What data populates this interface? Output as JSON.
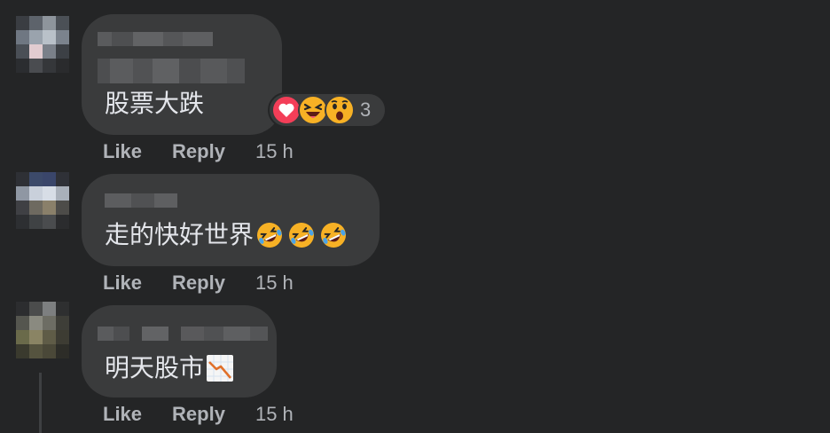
{
  "comments": [
    {
      "text": "股票大跌",
      "actions": {
        "like": "Like",
        "reply": "Reply",
        "time": "15 h"
      },
      "reactions": {
        "icons": [
          "heart-icon",
          "laughing-squint-icon",
          "wow-icon"
        ],
        "count": "3"
      }
    },
    {
      "text": "走的快好世界",
      "emojis": [
        "rolling-on-floor-laughing-icon",
        "rolling-on-floor-laughing-icon",
        "rolling-on-floor-laughing-icon"
      ],
      "actions": {
        "like": "Like",
        "reply": "Reply",
        "time": "15 h"
      }
    },
    {
      "text": "明天股市",
      "emojis": [
        "chart-decreasing-icon"
      ],
      "actions": {
        "like": "Like",
        "reply": "Reply",
        "time": "15 h"
      }
    }
  ],
  "colors": {
    "background": "#242526",
    "bubble": "#3a3b3c",
    "text": "#e4e6eb",
    "secondary_text": "#b0b3b8",
    "heart_red": "#f33e58",
    "emoji_yellow": "#f7b125"
  }
}
